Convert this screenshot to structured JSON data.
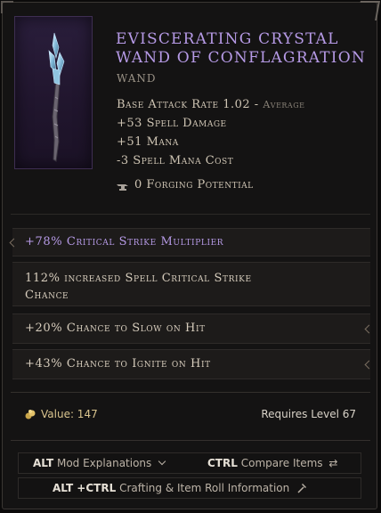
{
  "item": {
    "name_line1": "Eviscerating Crystal",
    "name_line2": "Wand of Conflagration",
    "type": "WAND",
    "base_attack_rate_label": "Base Attack Rate 1.02 - ",
    "base_attack_rate_qualifier": "Average",
    "implicits": [
      "+53 Spell Damage",
      "+51 Mana",
      "-3 Spell Mana Cost"
    ],
    "forging_potential": "0 Forging Potential"
  },
  "affixes": [
    {
      "text": "+78% Critical Strike Multiplier",
      "color": "#b69ae6"
    },
    {
      "text": "112% increased Spell Critical Strike",
      "text2": "Chance",
      "color": "#d7cdbd"
    },
    {
      "text": "+20% Chance to Slow on Hit",
      "color": "#d7cdbd"
    },
    {
      "text": "+43% Chance to Ignite on Hit",
      "color": "#d7cdbd"
    }
  ],
  "footer": {
    "value_label": "Value: 147",
    "requires_label": "Requires Level 67"
  },
  "hints": {
    "alt_key": "ALT",
    "alt_text": "Mod Explanations",
    "ctrl_key": "CTRL",
    "ctrl_text": "Compare Items",
    "altctrl_key": "ALT +CTRL",
    "altctrl_text": "Crafting & Item Roll Information"
  },
  "colors": {
    "legendary_purple": "#b69ae6",
    "value_gold": "#d9c48e",
    "background": "#141313"
  }
}
